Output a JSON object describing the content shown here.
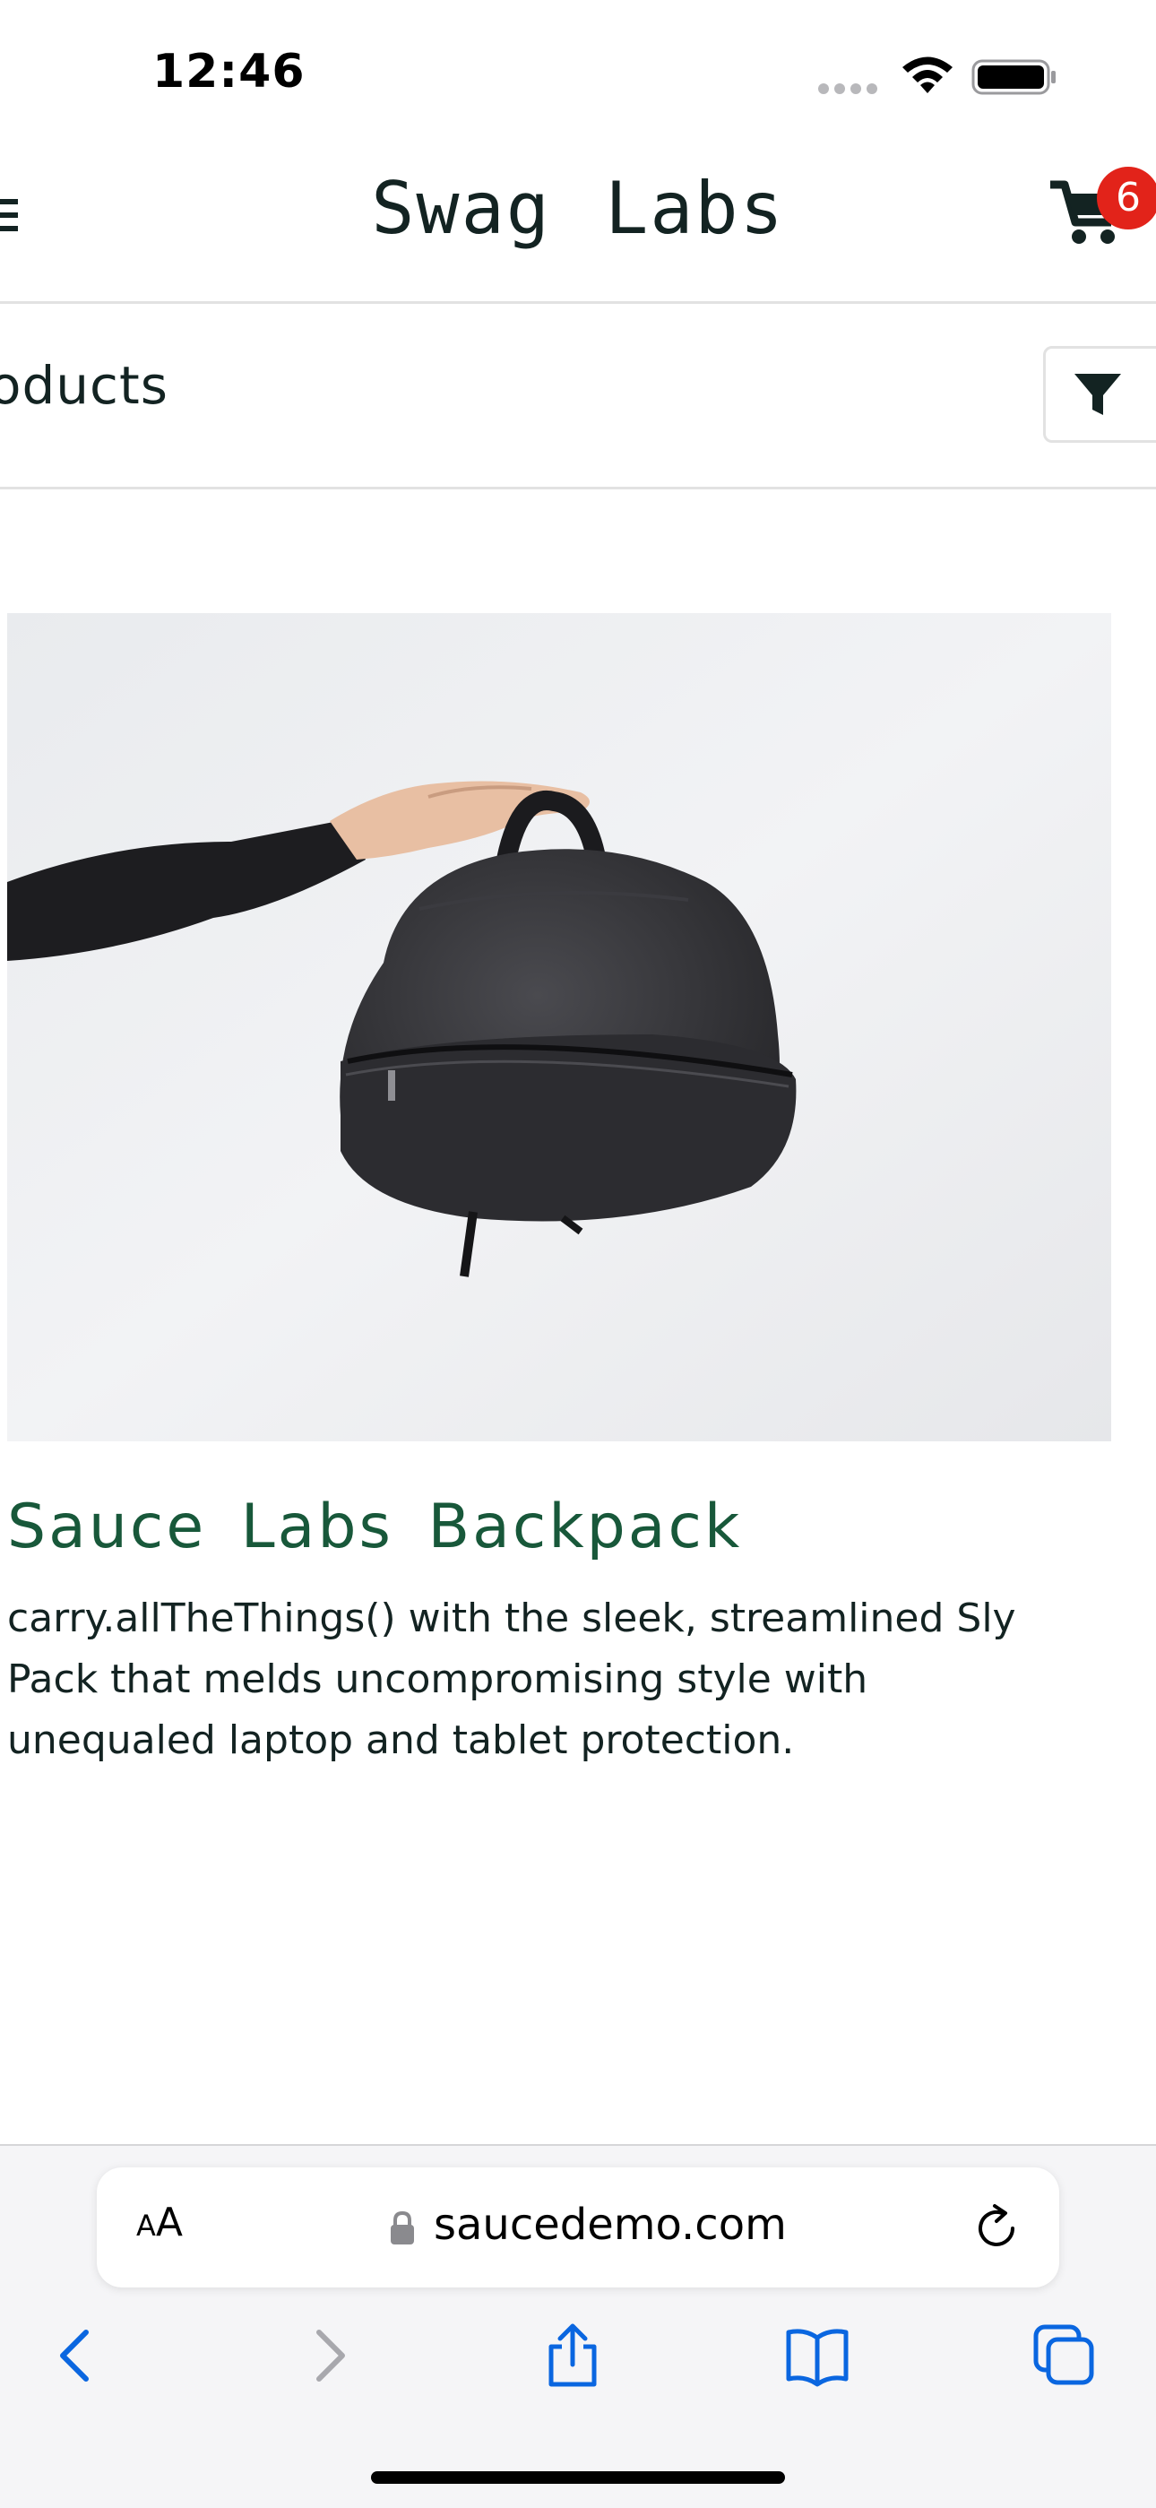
{
  "status_bar": {
    "time": "12:46",
    "icons": [
      "cellular-signal-icon",
      "wifi-icon",
      "battery-icon"
    ]
  },
  "header": {
    "menu_icon": "hamburger-menu-icon",
    "title": "Swag Labs",
    "cart_icon": "shopping-cart-icon",
    "cart_badge": "6"
  },
  "sub_header": {
    "title": "oducts",
    "sort_icon": "filter-funnel-icon"
  },
  "product": {
    "image": "backpack-photo",
    "name": "Sauce Labs Backpack",
    "description": "carry.allTheThings() with the sleek, streamlined Sly Pack that melds uncompromising style with unequaled laptop and tablet protection."
  },
  "browser": {
    "aa_small": "A",
    "aa_big": "A",
    "url": "saucedemo.com",
    "toolbar": [
      "back-icon",
      "forward-icon",
      "share-icon",
      "bookmarks-icon",
      "tabs-icon"
    ]
  },
  "colors": {
    "brand_text": "#132322",
    "product_name": "#18583a",
    "badge": "#e2231a",
    "safari_blue": "#0a66e0",
    "disabled_gray": "#a8a8ad"
  }
}
